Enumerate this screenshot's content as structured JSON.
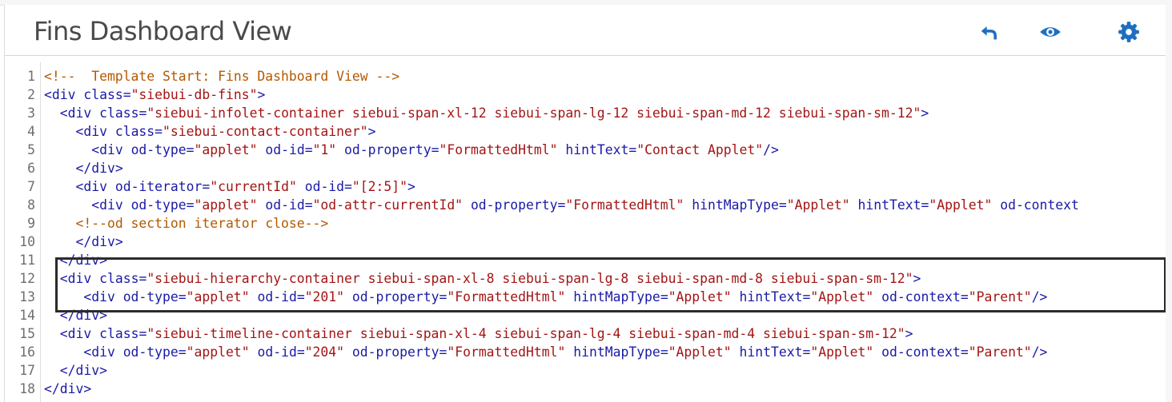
{
  "header": {
    "title": "Fins Dashboard View",
    "buttons": [
      {
        "name": "undo-icon",
        "label": "Undo",
        "color": "#1f6fbf"
      },
      {
        "name": "eye-icon",
        "label": "Preview",
        "color": "#1f6fbf"
      },
      {
        "name": "gear-icon",
        "label": "Settings",
        "color": "#1f6fbf"
      }
    ]
  },
  "editor": {
    "lines": [
      {
        "n": "1",
        "indent": "",
        "tokens": [
          [
            "com",
            "<!--  Template Start: Fins Dashboard View -->"
          ]
        ]
      },
      {
        "n": "2",
        "indent": "",
        "tokens": [
          [
            "tag",
            "<div "
          ],
          [
            "attr",
            "class"
          ],
          [
            "p",
            "="
          ],
          [
            "str",
            "\"siebui-db-fins\""
          ],
          [
            "tag",
            ">"
          ]
        ]
      },
      {
        "n": "3",
        "indent": "  ",
        "tokens": [
          [
            "tag",
            "<div "
          ],
          [
            "attr",
            "class"
          ],
          [
            "p",
            "="
          ],
          [
            "str",
            "\"siebui-infolet-container siebui-span-xl-12 siebui-span-lg-12 siebui-span-md-12 siebui-span-sm-12\""
          ],
          [
            "tag",
            ">"
          ]
        ]
      },
      {
        "n": "4",
        "indent": "    ",
        "tokens": [
          [
            "tag",
            "<div "
          ],
          [
            "attr",
            "class"
          ],
          [
            "p",
            "="
          ],
          [
            "str",
            "\"siebui-contact-container\""
          ],
          [
            "tag",
            ">"
          ]
        ]
      },
      {
        "n": "5",
        "indent": "      ",
        "tokens": [
          [
            "tag",
            "<div "
          ],
          [
            "attr",
            "od-type"
          ],
          [
            "p",
            "="
          ],
          [
            "str",
            "\"applet\""
          ],
          [
            "tag",
            " "
          ],
          [
            "attr",
            "od-id"
          ],
          [
            "p",
            "="
          ],
          [
            "str",
            "\"1\""
          ],
          [
            "tag",
            " "
          ],
          [
            "attr",
            "od-property"
          ],
          [
            "p",
            "="
          ],
          [
            "str",
            "\"FormattedHtml\""
          ],
          [
            "tag",
            " "
          ],
          [
            "attr",
            "hintText"
          ],
          [
            "p",
            "="
          ],
          [
            "str",
            "\"Contact Applet\""
          ],
          [
            "tag",
            "/>"
          ]
        ]
      },
      {
        "n": "6",
        "indent": "    ",
        "tokens": [
          [
            "tag",
            "</div>"
          ]
        ]
      },
      {
        "n": "7",
        "indent": "    ",
        "tokens": [
          [
            "tag",
            "<div "
          ],
          [
            "attr",
            "od-iterator"
          ],
          [
            "p",
            "="
          ],
          [
            "str",
            "\"currentId\""
          ],
          [
            "tag",
            " "
          ],
          [
            "attr",
            "od-id"
          ],
          [
            "p",
            "="
          ],
          [
            "str",
            "\"[2:5]\""
          ],
          [
            "tag",
            ">"
          ]
        ]
      },
      {
        "n": "8",
        "indent": "      ",
        "tokens": [
          [
            "tag",
            "<div "
          ],
          [
            "attr",
            "od-type"
          ],
          [
            "p",
            "="
          ],
          [
            "str",
            "\"applet\""
          ],
          [
            "tag",
            " "
          ],
          [
            "attr",
            "od-id"
          ],
          [
            "p",
            "="
          ],
          [
            "str",
            "\"od-attr-currentId\""
          ],
          [
            "tag",
            " "
          ],
          [
            "attr",
            "od-property"
          ],
          [
            "p",
            "="
          ],
          [
            "str",
            "\"FormattedHtml\""
          ],
          [
            "tag",
            " "
          ],
          [
            "attr",
            "hintMapType"
          ],
          [
            "p",
            "="
          ],
          [
            "str",
            "\"Applet\""
          ],
          [
            "tag",
            " "
          ],
          [
            "attr",
            "hintText"
          ],
          [
            "p",
            "="
          ],
          [
            "str",
            "\"Applet\""
          ],
          [
            "tag",
            " "
          ],
          [
            "attr",
            "od-context"
          ]
        ]
      },
      {
        "n": "9",
        "indent": "    ",
        "tokens": [
          [
            "com",
            "<!--od section iterator close-->"
          ]
        ]
      },
      {
        "n": "10",
        "indent": "    ",
        "tokens": [
          [
            "tag",
            "</div>"
          ]
        ]
      },
      {
        "n": "11",
        "indent": "  ",
        "tokens": [
          [
            "tag",
            "</div>"
          ]
        ]
      },
      {
        "n": "12",
        "indent": "  ",
        "tokens": [
          [
            "tag",
            "<div "
          ],
          [
            "attr",
            "class"
          ],
          [
            "p",
            "="
          ],
          [
            "str",
            "\"siebui-hierarchy-container siebui-span-xl-8 siebui-span-lg-8 siebui-span-md-8 siebui-span-sm-12\""
          ],
          [
            "tag",
            ">"
          ]
        ]
      },
      {
        "n": "13",
        "indent": "     ",
        "tokens": [
          [
            "tag",
            "<div "
          ],
          [
            "attr",
            "od-type"
          ],
          [
            "p",
            "="
          ],
          [
            "str",
            "\"applet\""
          ],
          [
            "tag",
            " "
          ],
          [
            "attr",
            "od-id"
          ],
          [
            "p",
            "="
          ],
          [
            "str",
            "\"201\""
          ],
          [
            "tag",
            " "
          ],
          [
            "attr",
            "od-property"
          ],
          [
            "p",
            "="
          ],
          [
            "str",
            "\"FormattedHtml\""
          ],
          [
            "tag",
            " "
          ],
          [
            "attr",
            "hintMapType"
          ],
          [
            "p",
            "="
          ],
          [
            "str",
            "\"Applet\""
          ],
          [
            "tag",
            " "
          ],
          [
            "attr",
            "hintText"
          ],
          [
            "p",
            "="
          ],
          [
            "str",
            "\"Applet\""
          ],
          [
            "tag",
            " "
          ],
          [
            "attr",
            "od-context"
          ],
          [
            "p",
            "="
          ],
          [
            "str",
            "\"Parent\""
          ],
          [
            "tag",
            "/>"
          ]
        ]
      },
      {
        "n": "14",
        "indent": "  ",
        "tokens": [
          [
            "tag",
            "</div>"
          ]
        ]
      },
      {
        "n": "15",
        "indent": "  ",
        "tokens": [
          [
            "tag",
            "<div "
          ],
          [
            "attr",
            "class"
          ],
          [
            "p",
            "="
          ],
          [
            "str",
            "\"siebui-timeline-container siebui-span-xl-4 siebui-span-lg-4 siebui-span-md-4 siebui-span-sm-12\""
          ],
          [
            "tag",
            ">"
          ]
        ]
      },
      {
        "n": "16",
        "indent": "     ",
        "tokens": [
          [
            "tag",
            "<div "
          ],
          [
            "attr",
            "od-type"
          ],
          [
            "p",
            "="
          ],
          [
            "str",
            "\"applet\""
          ],
          [
            "tag",
            " "
          ],
          [
            "attr",
            "od-id"
          ],
          [
            "p",
            "="
          ],
          [
            "str",
            "\"204\""
          ],
          [
            "tag",
            " "
          ],
          [
            "attr",
            "od-property"
          ],
          [
            "p",
            "="
          ],
          [
            "str",
            "\"FormattedHtml\""
          ],
          [
            "tag",
            " "
          ],
          [
            "attr",
            "hintMapType"
          ],
          [
            "p",
            "="
          ],
          [
            "str",
            "\"Applet\""
          ],
          [
            "tag",
            " "
          ],
          [
            "attr",
            "hintText"
          ],
          [
            "p",
            "="
          ],
          [
            "str",
            "\"Applet\""
          ],
          [
            "tag",
            " "
          ],
          [
            "attr",
            "od-context"
          ],
          [
            "p",
            "="
          ],
          [
            "str",
            "\"Parent\""
          ],
          [
            "tag",
            "/>"
          ]
        ]
      },
      {
        "n": "17",
        "indent": "  ",
        "tokens": [
          [
            "tag",
            "</div>"
          ]
        ]
      },
      {
        "n": "18",
        "indent": "",
        "tokens": [
          [
            "tag",
            "</div>"
          ]
        ]
      }
    ],
    "highlighted_lines": [
      "12",
      "13",
      "14"
    ]
  }
}
